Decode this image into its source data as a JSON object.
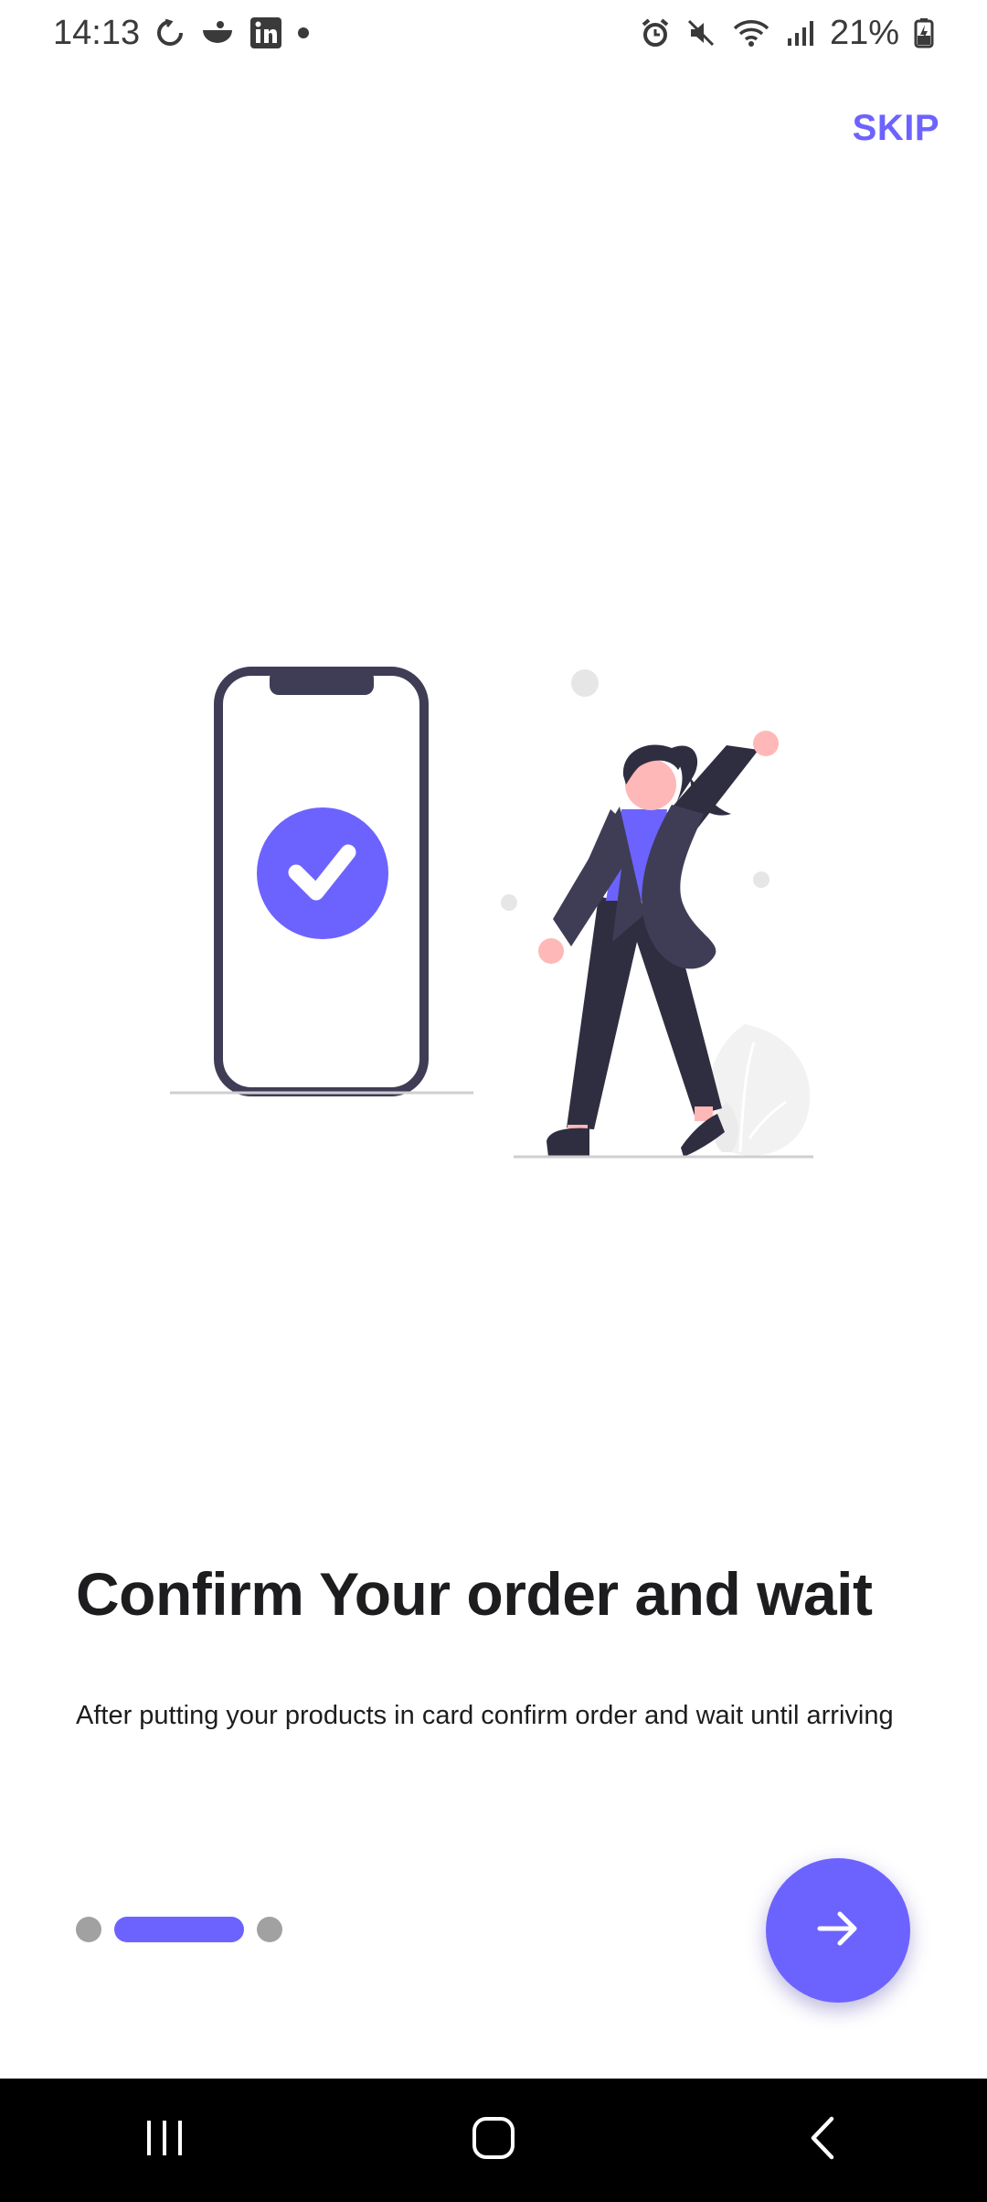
{
  "status_bar": {
    "time": "14:13",
    "battery": "21%"
  },
  "onboarding": {
    "skip_label": "SKIP",
    "title": "Confirm Your order and wait",
    "subtitle": "After putting your products in card confirm order and wait until arriving",
    "page_count": 3,
    "current_page": 2,
    "next_icon": "arrow-right-icon"
  },
  "colors": {
    "accent": "#6c63ff",
    "dark": "#2f2e41",
    "skin": "#ffb8b8",
    "inactive_dot": "#a1a1a1"
  },
  "nav_bar": {
    "recents_icon": "recents-icon",
    "home_icon": "home-icon",
    "back_icon": "back-icon"
  }
}
